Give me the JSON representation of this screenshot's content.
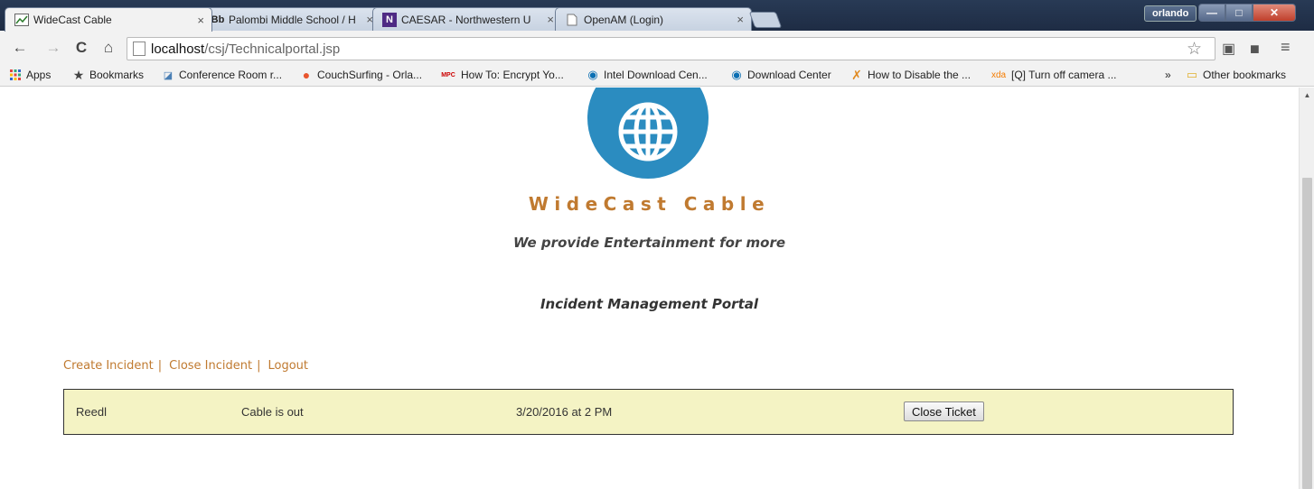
{
  "browser": {
    "tabs": [
      {
        "title": "WideCast Cable",
        "favicon": "widecast-favicon",
        "close": "×",
        "active": true
      },
      {
        "title": "Palombi Middle School / H",
        "favicon_text": "Bb",
        "close": "×",
        "active": false
      },
      {
        "title": "CAESAR - Northwestern U",
        "favicon_text": "N",
        "close": "×",
        "active": false
      },
      {
        "title": "OpenAM (Login)",
        "favicon": "page-icon",
        "close": "×",
        "active": false
      }
    ],
    "user_name": "orlando",
    "window_controls": {
      "minimize": "—",
      "maximize": "□",
      "close": "✕"
    },
    "url": {
      "host": "localhost",
      "path": "/csj/Technicalportal.jsp"
    },
    "bookmarks": [
      {
        "label": "Apps",
        "icon": "apps-grid-icon"
      },
      {
        "label": "Bookmarks",
        "icon": "star-icon"
      },
      {
        "label": "Conference Room r...",
        "icon": "conference-icon"
      },
      {
        "label": "CouchSurfing - Orla...",
        "icon": "couchsurfing-icon"
      },
      {
        "label": "How To: Encrypt Yo...",
        "icon": "mpc-icon",
        "icon_text": "MPC"
      },
      {
        "label": "Intel Download Cen...",
        "icon": "intel-icon"
      },
      {
        "label": "Download Center",
        "icon": "intel-icon"
      },
      {
        "label": "How to Disable the ...",
        "icon": "figure-icon"
      },
      {
        "label": "[Q] Turn off camera ...",
        "icon": "xda-icon",
        "icon_text": "xda"
      }
    ],
    "overflow": "»",
    "other_bookmarks": "Other bookmarks"
  },
  "page": {
    "brand_name": "WideCast Cable",
    "tagline": "We provide Entertainment for more",
    "portal_title": "Incident Management Portal",
    "menu": {
      "create_incident": "Create Incident",
      "close_incident": "Close Incident",
      "logout": "Logout",
      "separator": "|"
    },
    "tickets": [
      {
        "user": "Reedl",
        "issue": "Cable is out",
        "reported": "3/20/2016 at 2 PM",
        "action_label": "Close Ticket"
      }
    ]
  },
  "colors": {
    "brand": "#c07a30",
    "logo": "#2b8cc0",
    "ticket_bg": "#f4f3c4"
  }
}
